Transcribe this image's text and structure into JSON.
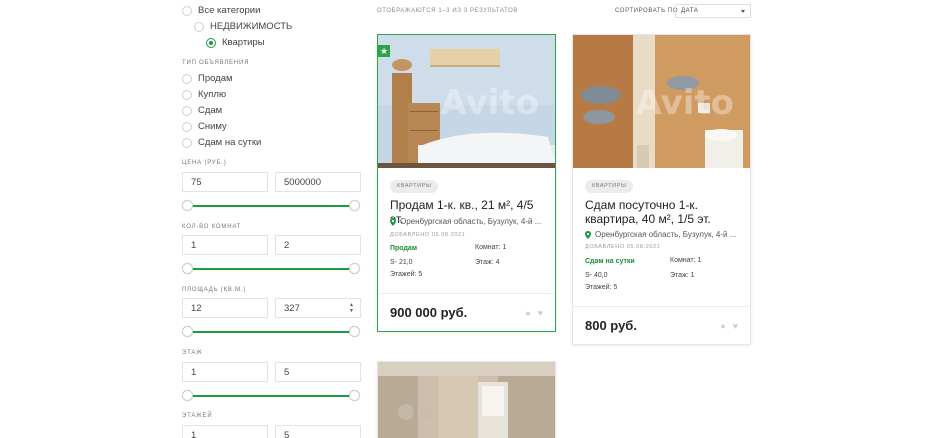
{
  "sidebar": {
    "categories": [
      {
        "label": "Все категории",
        "selected": false
      },
      {
        "label": "НЕДВИЖИМОСТЬ",
        "selected": false
      },
      {
        "label": "Квартиры",
        "selected": true
      }
    ],
    "type_section": "ТИП ОБЪЯВЛЕНИЯ",
    "types": [
      "Продам",
      "Куплю",
      "Сдам",
      "Сниму",
      "Сдам на сутки"
    ],
    "price": {
      "label": "ЦЕНА (РУБ.)",
      "min": "75",
      "max": "5000000"
    },
    "rooms": {
      "label": "КОЛ-ВО КОМНАТ",
      "min": "1",
      "max": "2"
    },
    "area": {
      "label": "ПЛОЩАДЬ (КВ.М.)",
      "min": "12",
      "max": "327"
    },
    "floor": {
      "label": "ЭТАЖ",
      "min": "1",
      "max": "5"
    },
    "floors": {
      "label": "ЭТАЖЕЙ",
      "min": "1",
      "max": "5"
    }
  },
  "toolbar": {
    "results_text": "ОТОБРАЖАЮТСЯ 1–3 ИЗ 3 РЕЗУЛЬТАТОВ",
    "sort_label": "СОРТИРОВАТЬ ПО",
    "sort_value": "ДАТА"
  },
  "listings": [
    {
      "badge": "КВАРТИРЫ",
      "title": "Продам 1-к. кв., 21 м², 4/5 эт.",
      "location": "Оренбургская область, Бузулук, 4-й ...",
      "added": "ДОБАВЛЕНО 05.08.2021",
      "deal": "Продам",
      "rooms": "Комнат: 1",
      "area": "S- 21,0",
      "floor": "Этаж: 4",
      "floors": "Этажей: 5",
      "price": "900 000 руб.",
      "featured": true
    },
    {
      "badge": "КВАРТИРЫ",
      "title": "Сдам посуточно 1-к. квартира, 40 м², 1/5 эт.",
      "location": "Оренбургская область, Бузулук, 4-й ...",
      "added": "ДОБАВЛЕНО 05.08.2021",
      "deal": "Сдам на сутки",
      "rooms": "Комнат: 1",
      "area": "S- 40,0",
      "floor": "Этаж: 1",
      "floors": "Этажей: 5",
      "price": "800 руб.",
      "featured": false
    }
  ],
  "watermark": "Avito",
  "colors": {
    "accent": "#1c9b3f",
    "featured_border": "#2aa64a"
  },
  "icons": [
    "star-icon",
    "map-pin-icon",
    "comment-icon",
    "heart-icon",
    "chevron-down-icon"
  ]
}
